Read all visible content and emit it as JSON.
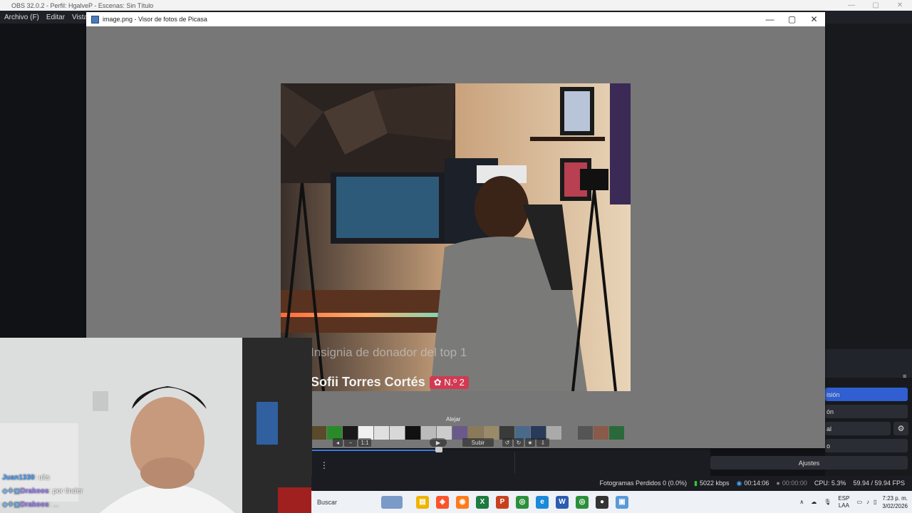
{
  "obs": {
    "title": "OBS 32.0.2 - Perfil: HgalveP - Escenas: Sin Título",
    "menu": [
      "Archivo (F)",
      "Editar",
      "Vista"
    ],
    "right_panel": {
      "items": [
        "isión",
        "ón",
        "al",
        "o"
      ],
      "settings_label": "Ajustes"
    },
    "status": {
      "dropped": "Fotogramas Perdidos 0 (0.0%)",
      "bitrate": "5022 kbps",
      "live_time": "00:14:06",
      "rec_time": "00:00:00",
      "cpu": "CPU: 5.3%",
      "fps": "59.94 / 59.94 FPS"
    }
  },
  "picasa": {
    "title": "image.png - Visor de fotos de Picasa",
    "overlay_line1": "Insignia de donador del top 1",
    "overlay_name": "Sofii Torres Cortés",
    "overlay_badge": "N.º 2",
    "filmstrip_label": "Alejar",
    "ctl_ratio": "1:1",
    "ctl_upload": "Subir"
  },
  "chat": [
    {
      "user": "Juan1330",
      "message": ": uits"
    },
    {
      "user": "Drakoos",
      "message": ": por tinder"
    },
    {
      "user": "Drakoos",
      "message": ": ..."
    }
  ],
  "taskbar": {
    "search_placeholder": "Buscar",
    "lang_top": "ESP",
    "lang_bottom": "LAA",
    "time": "7:23 p. m.",
    "date": "3/02/2026"
  },
  "colors": {
    "accent": "#2f5fd0",
    "picasa_bg": "#777777",
    "obs_bg": "#111216"
  }
}
